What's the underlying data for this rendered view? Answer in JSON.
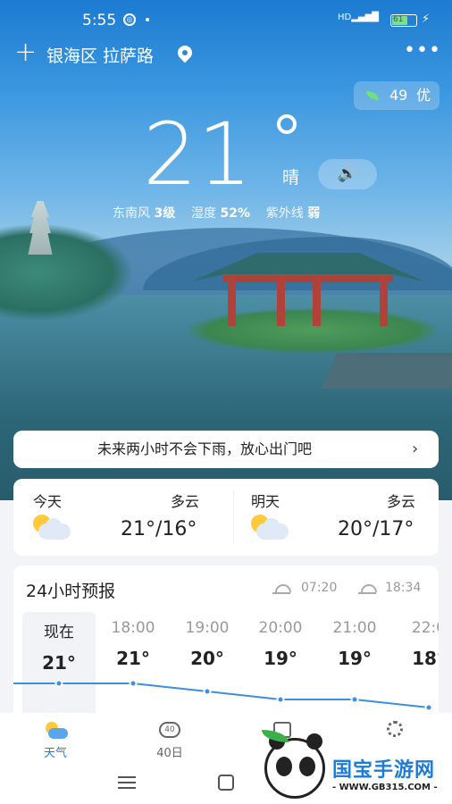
{
  "status_bar": {
    "time": "5:55",
    "signal": "HD",
    "battery": "61"
  },
  "header": {
    "location": "银海区 拉萨路"
  },
  "aqi": {
    "value": "49",
    "quality": "优",
    "color": "#6fe07c"
  },
  "current": {
    "temperature": "21",
    "condition": "晴",
    "details": [
      {
        "label": "东南风",
        "value": "3级"
      },
      {
        "label": "湿度",
        "value": "52%"
      },
      {
        "label": "紫外线",
        "value": "弱"
      }
    ]
  },
  "rain_notice": "未来两小时不会下雨，放心出门吧",
  "days": [
    {
      "label": "今天",
      "condition": "多云",
      "temps": "21°/16°",
      "icon": "partly-cloudy-icon"
    },
    {
      "label": "明天",
      "condition": "多云",
      "temps": "20°/17°",
      "icon": "partly-cloudy-icon"
    }
  ],
  "hourly": {
    "title": "24小时预报",
    "sunrise": "07:20",
    "sunset": "18:34",
    "hours": [
      {
        "time": "现在",
        "temp": "21°",
        "value": 21
      },
      {
        "time": "18:00",
        "temp": "21°",
        "value": 21
      },
      {
        "time": "19:00",
        "temp": "20°",
        "value": 20
      },
      {
        "time": "20:00",
        "temp": "19°",
        "value": 19
      },
      {
        "time": "21:00",
        "temp": "19°",
        "value": 19
      },
      {
        "time": "22:0",
        "temp": "18°",
        "value": 18
      }
    ]
  },
  "bottom_nav": [
    {
      "label": "天气",
      "icon": "weather-icon",
      "active": true
    },
    {
      "label": "40日",
      "icon": "forty-day-icon",
      "active": false,
      "badge": "40"
    },
    {
      "label": "",
      "icon": "calendar-icon",
      "active": false
    },
    {
      "label": "",
      "icon": "settings-icon",
      "active": false
    }
  ],
  "watermark": {
    "brand": "国宝手游网",
    "url": "- WWW.GB315.COM -"
  },
  "colors": {
    "accent": "#1f7fe0",
    "sky_top": "#1d7bd1",
    "line": "#3c8ee0"
  }
}
